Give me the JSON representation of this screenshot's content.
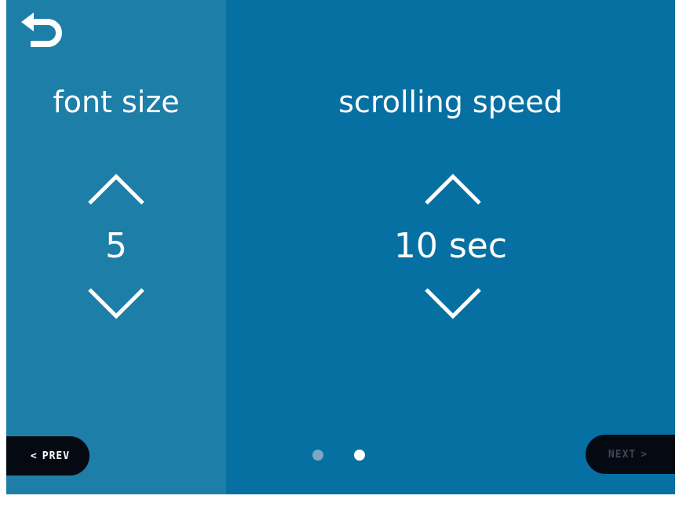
{
  "colors": {
    "left_panel": "#1d7ea8",
    "right_panel": "#0670a2",
    "button_bg": "#050a12",
    "dot_inactive": "#7ea7c3",
    "dot_active": "#ffffff",
    "next_disabled_text": "#3d4655"
  },
  "header": {
    "back_icon": "back-arrow-icon"
  },
  "font_size": {
    "title": "font size",
    "value": "5",
    "increase_icon": "chevron-up-icon",
    "decrease_icon": "chevron-down-icon"
  },
  "scrolling_speed": {
    "title": "scrolling speed",
    "value": "10 sec",
    "increase_icon": "chevron-up-icon",
    "decrease_icon": "chevron-down-icon"
  },
  "pagination": {
    "total": 2,
    "active": 2
  },
  "footer": {
    "prev_label": "PREV",
    "prev_icon": "<",
    "next_label": "NEXT",
    "next_icon": ">",
    "next_enabled": false
  }
}
